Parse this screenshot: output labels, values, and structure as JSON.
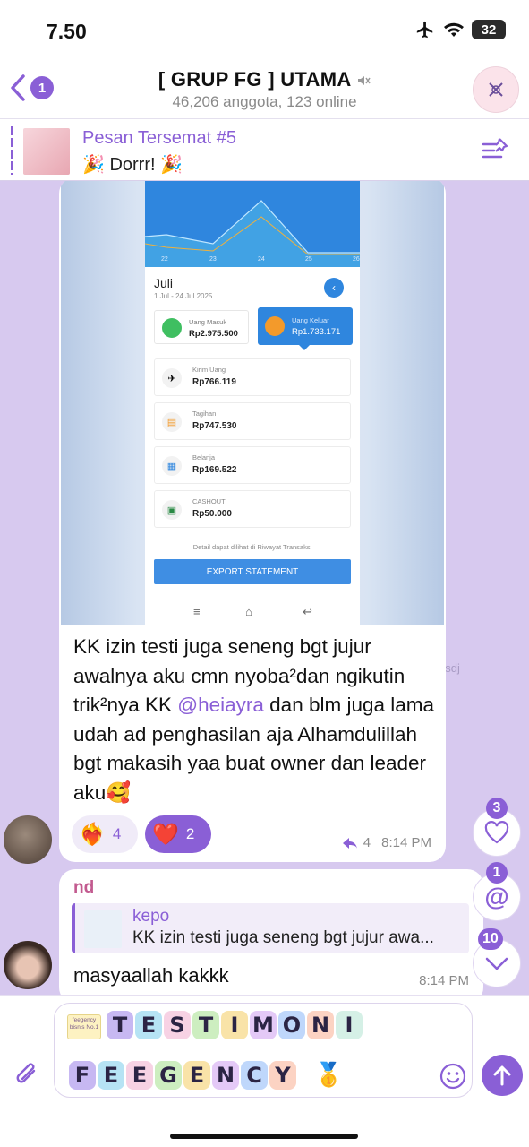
{
  "status_bar": {
    "time": "7.50",
    "battery": "32"
  },
  "header": {
    "back_count": "1",
    "title": "[ GRUP FG ] UTAMA",
    "subtitle": "46,206 anggota, 123 online",
    "avatar_icon": "group-logo-icon"
  },
  "pinned": {
    "title": "Pesan Tersemat #5",
    "text": "🎉 Dorrr! 🎉"
  },
  "message1": {
    "screenshot": {
      "chart_ticks": [
        "22",
        "23",
        "24",
        "25",
        "26"
      ],
      "month": "Juli",
      "range": "1 Jul - 24 Jul 2025",
      "in_label": "Uang Masuk",
      "in_value": "Rp2.975.500",
      "out_label": "Uang Keluar",
      "out_value": "Rp1.733.171",
      "rows": [
        {
          "label": "Kirim Uang",
          "value": "Rp766.119"
        },
        {
          "label": "Tagihan",
          "value": "Rp747.530"
        },
        {
          "label": "Belanja",
          "value": "Rp169.522"
        },
        {
          "label": "CASHOUT",
          "value": "Rp50.000"
        }
      ],
      "detail_note": "Detail dapat dilihat di Riwayat Transaksi",
      "export_label": "EXPORT STATEMENT"
    },
    "text_before": "KK izin testi juga seneng bgt jujur awalnya aku cmn nyoba²dan ngikutin trik²nya KK ",
    "mention": "@heiayra",
    "text_after": " dan blm juga lama udah ad penghasilan aja Alhamdulillah bgt makasih yaa buat owner dan leader aku🥰",
    "reactions": [
      {
        "emoji": "❤️‍🔥",
        "count": "4"
      },
      {
        "emoji": "❤️",
        "count": "2"
      }
    ],
    "forwards": "4",
    "time": "8:14 PM"
  },
  "watermark": "asdj",
  "message2": {
    "sender": "nd",
    "reply_name": "kepo",
    "reply_text": "KK izin testi juga seneng bgt jujur awa...",
    "text": "masyaallah kakkk",
    "time": "8:14 PM"
  },
  "floating": {
    "reactions_badge": "3",
    "mentions_badge": "1",
    "unread_badge": "10"
  },
  "input": {
    "sticker_badge": "feegency bisnis No.1",
    "line1": [
      "T",
      "E",
      "S",
      "T",
      "I",
      "M",
      "O",
      "N",
      "I"
    ],
    "line2": [
      "F",
      "E",
      "E",
      "G",
      "E",
      "N",
      "C",
      "Y"
    ],
    "medal": "🥇"
  },
  "colors": {
    "accent": "#8a5fd6",
    "chat_bg": "#d7c9ef",
    "app_blue": "#2f86de"
  }
}
